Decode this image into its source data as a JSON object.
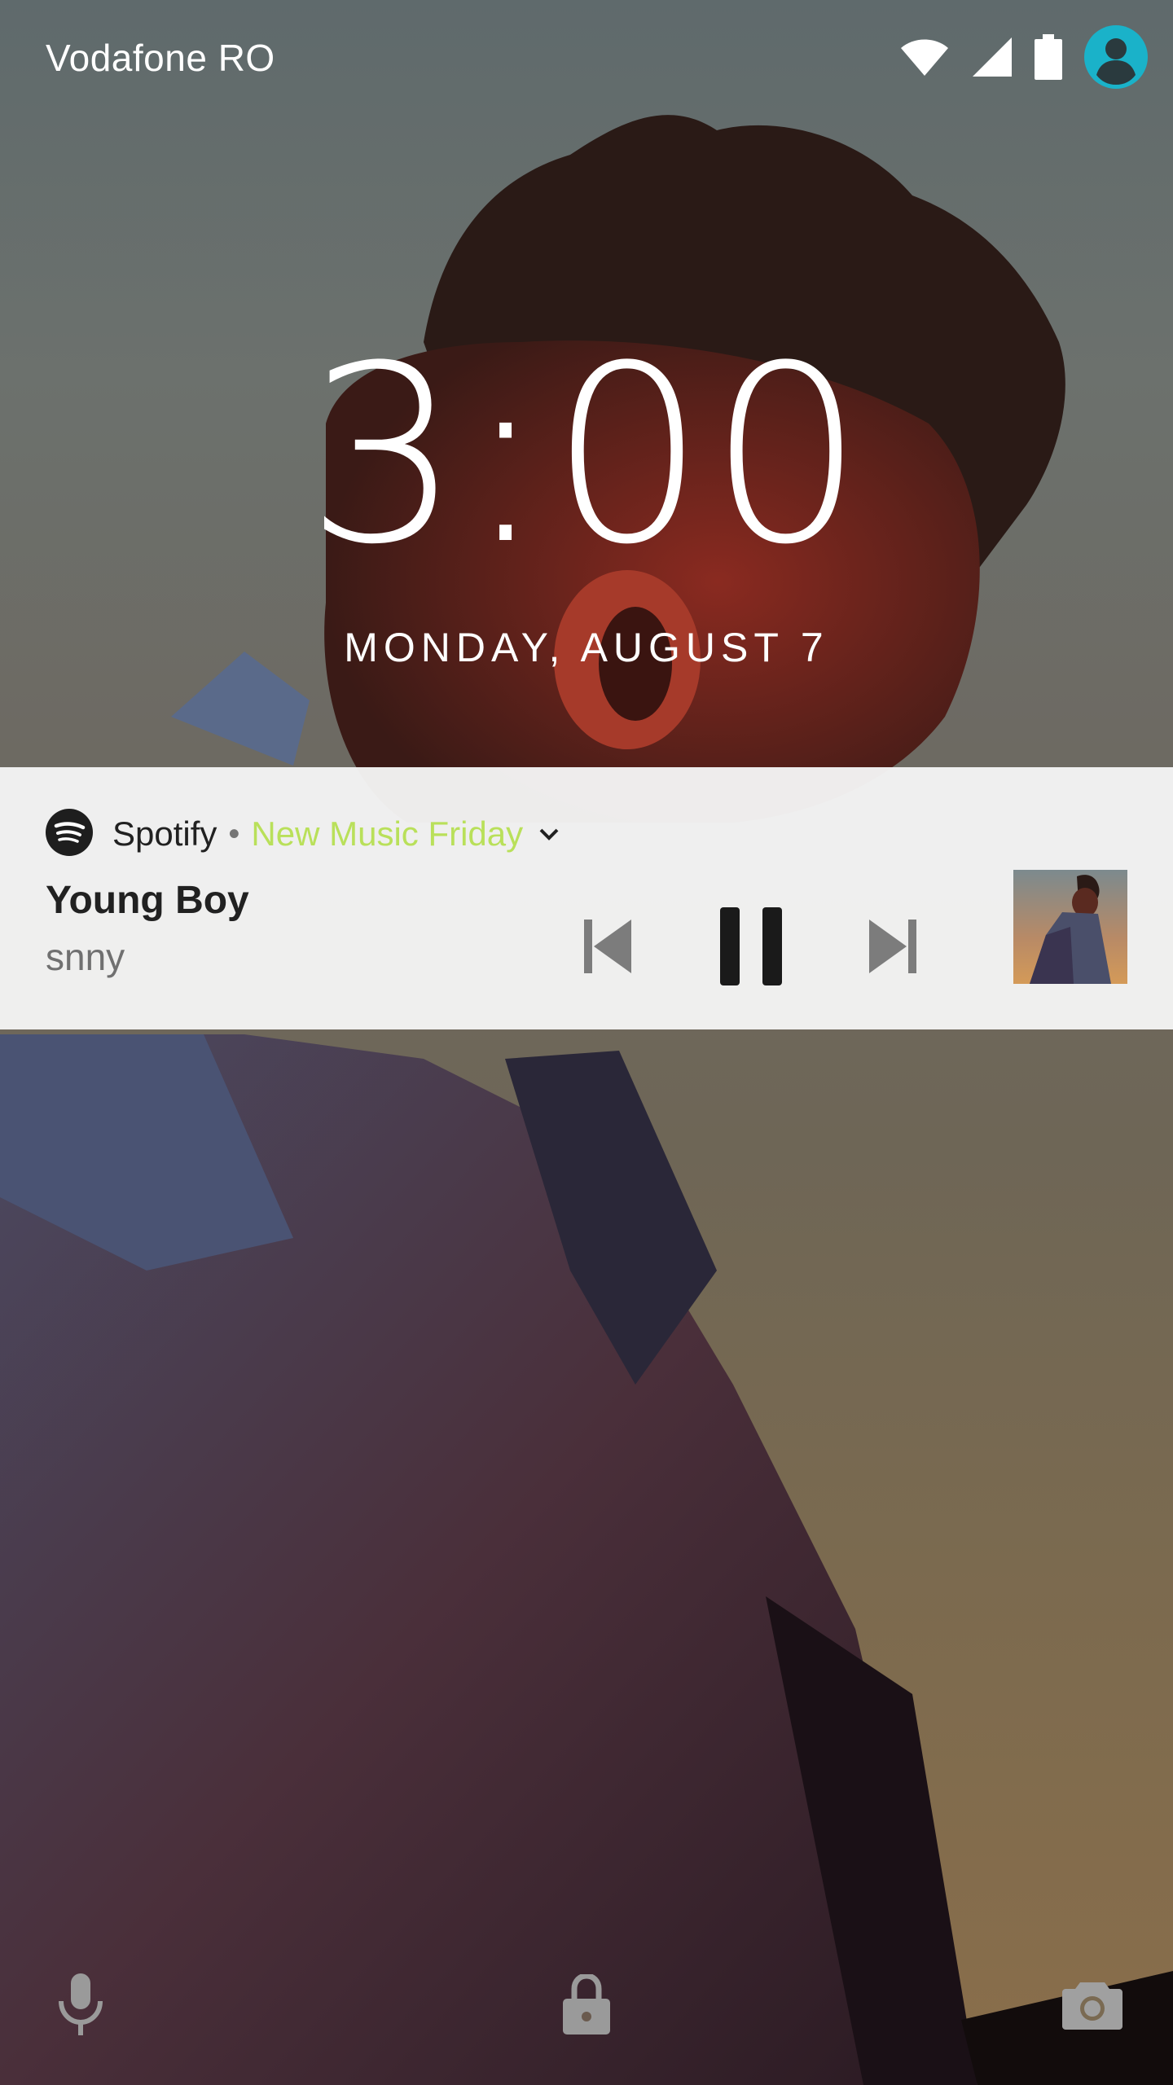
{
  "status_bar": {
    "carrier": "Vodafone RO",
    "icons": [
      "wifi-icon",
      "cell-signal-icon",
      "battery-icon",
      "user-avatar-icon"
    ],
    "accent_color": "#1ab2c9"
  },
  "lockscreen": {
    "time": "3:00",
    "date": "MONDAY, AUGUST 7"
  },
  "media_notification": {
    "app_name": "Spotify",
    "playlist": "New Music Friday",
    "playlist_color": "#b9e05a",
    "track_title": "Young Boy",
    "artist": "snny",
    "controls": [
      "previous",
      "pause",
      "next"
    ],
    "album_art": "album-art-thumbnail"
  },
  "bottom_shortcuts": [
    "mic-icon",
    "lock-icon",
    "camera-icon"
  ]
}
